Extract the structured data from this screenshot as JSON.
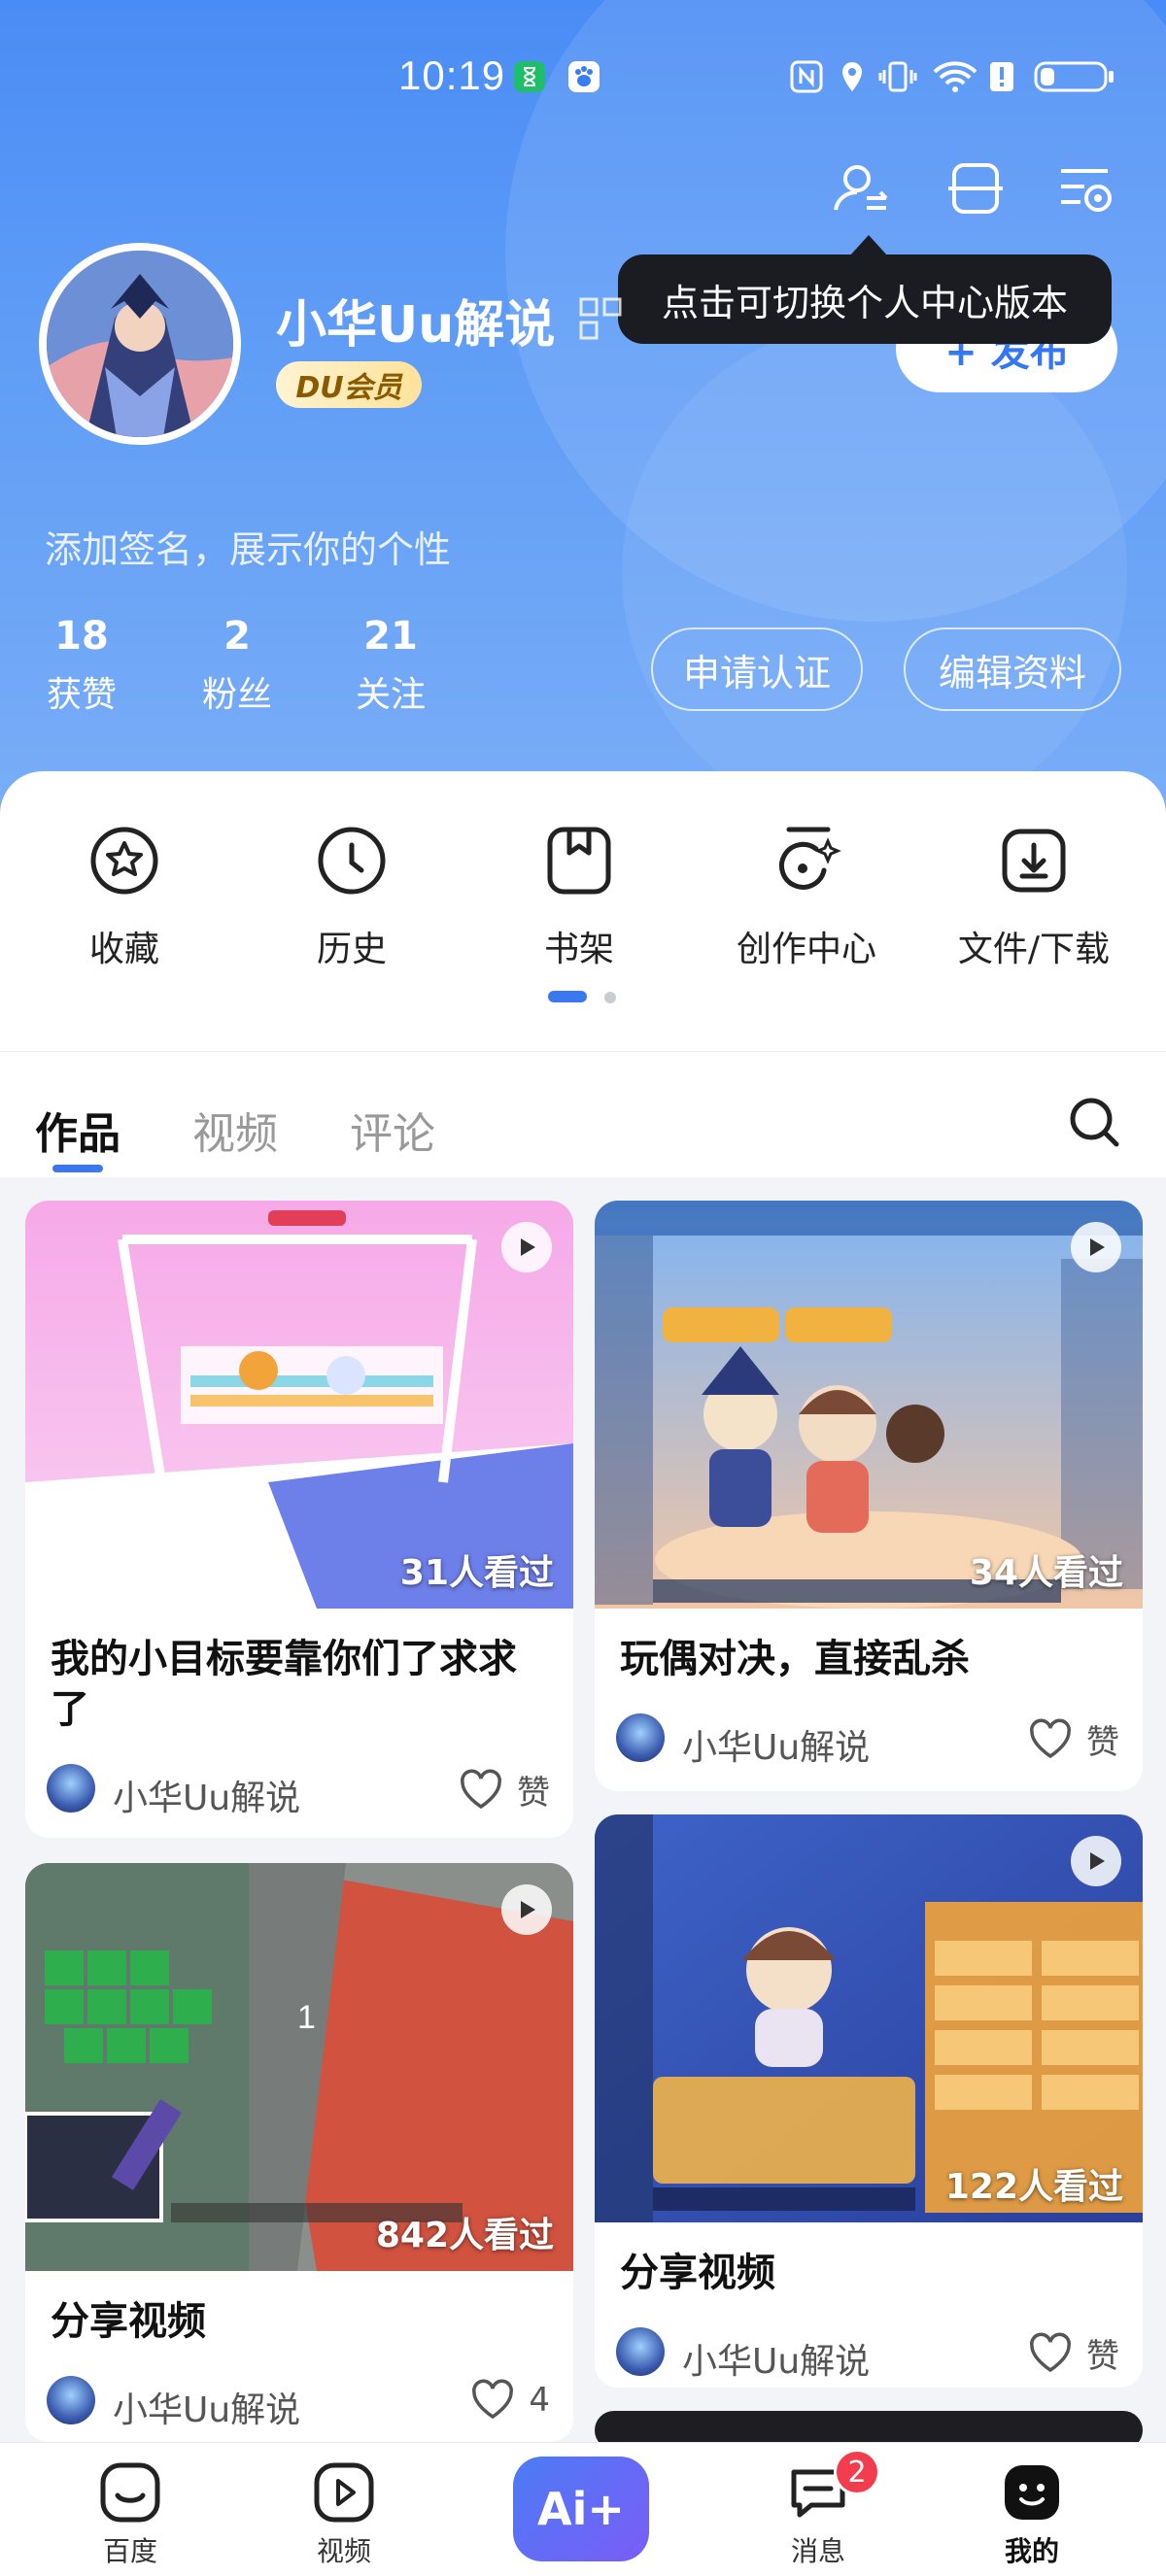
{
  "status_bar": {
    "time": "10:19"
  },
  "tooltip": {
    "text": "点击可切换个人中心版本"
  },
  "profile": {
    "username": "小华Uu解说",
    "vip_badge": "DU会员",
    "signature": "添加签名，展示你的个性",
    "publish_label": "+ 发布",
    "stats": [
      {
        "value": "18",
        "label": "获赞"
      },
      {
        "value": "2",
        "label": "粉丝"
      },
      {
        "value": "21",
        "label": "关注"
      }
    ],
    "apply_verify_label": "申请认证",
    "edit_profile_label": "编辑资料"
  },
  "quick_actions": [
    {
      "label": "收藏",
      "icon": "star-icon"
    },
    {
      "label": "历史",
      "icon": "clock-icon"
    },
    {
      "label": "书架",
      "icon": "bookmark-icon"
    },
    {
      "label": "创作中心",
      "icon": "creator-icon"
    },
    {
      "label": "文件/下载",
      "icon": "download-icon"
    }
  ],
  "content_tabs": [
    "作品",
    "视频",
    "评论"
  ],
  "cards": [
    {
      "title": "我的小目标要靠你们了求求了",
      "views": "31人看过",
      "author": "小华Uu解说",
      "like": "赞"
    },
    {
      "title": "玩偶对决，直接乱杀",
      "views": "34人看过",
      "author": "小华Uu解说",
      "like": "赞"
    },
    {
      "title": "分享视频",
      "views": "842人看过",
      "author": "小华Uu解说",
      "like": "4"
    },
    {
      "title": "分享视频",
      "views": "122人看过",
      "author": "小华Uu解说",
      "like": "赞"
    }
  ],
  "bottom_nav": {
    "items": [
      "百度",
      "视频",
      "消息",
      "我的"
    ],
    "ai_label": "Ai+",
    "message_badge": "2"
  },
  "colors": {
    "accent": "#3b78f0",
    "header_top": "#4a8cf5",
    "badge_red": "#f23d4f"
  }
}
